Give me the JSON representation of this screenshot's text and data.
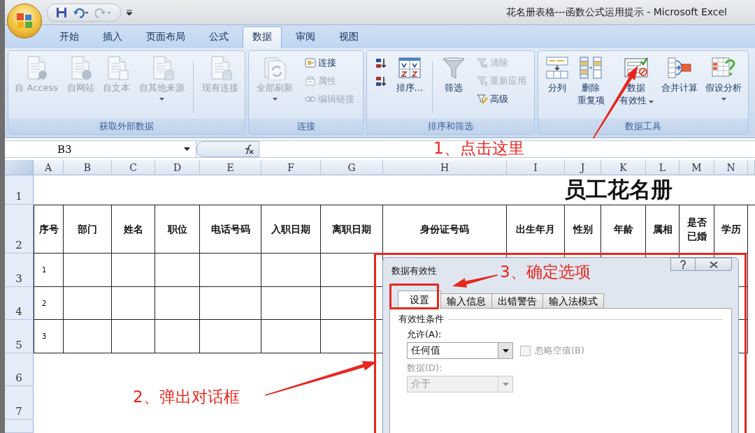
{
  "window": {
    "title": "花名册表格---函数公式运用提示 - Microsoft Excel"
  },
  "ribbon_tabs": [
    {
      "label": "开始",
      "selected": false
    },
    {
      "label": "插入",
      "selected": false
    },
    {
      "label": "页面布局",
      "selected": false
    },
    {
      "label": "公式",
      "selected": false
    },
    {
      "label": "数据",
      "selected": true
    },
    {
      "label": "审阅",
      "selected": false
    },
    {
      "label": "视图",
      "selected": false
    }
  ],
  "ribbon_groups": [
    {
      "title": "获取外部数据",
      "items": [
        {
          "kind": "large",
          "label": "自 Access",
          "disabled": true
        },
        {
          "kind": "large",
          "label": "自网站",
          "disabled": true
        },
        {
          "kind": "large",
          "label": "自文本",
          "disabled": true
        },
        {
          "kind": "large",
          "label": "自其他来源",
          "disabled": true,
          "dropdown": true
        },
        {
          "kind": "separator"
        },
        {
          "kind": "large",
          "label": "现有连接",
          "disabled": true
        }
      ]
    },
    {
      "title": "连接",
      "items": [
        {
          "kind": "large",
          "label": "全部刷新",
          "disabled": true,
          "dropdown": true
        },
        {
          "kind": "stack",
          "items": [
            {
              "label": "连接",
              "disabled": false
            },
            {
              "label": "属性",
              "disabled": true
            },
            {
              "label": "编辑链接",
              "disabled": true
            }
          ]
        }
      ]
    },
    {
      "title": "排序和筛选",
      "items": [
        {
          "kind": "stack",
          "items": [
            {
              "disabled": false
            },
            {
              "disabled": false
            }
          ]
        },
        {
          "kind": "large",
          "label": "排序...",
          "disabled": false
        },
        {
          "kind": "separator"
        },
        {
          "kind": "large",
          "label": "筛选",
          "disabled": false
        },
        {
          "kind": "stack",
          "items": [
            {
              "label": "清除",
              "disabled": true
            },
            {
              "label": "重新应用",
              "disabled": true
            },
            {
              "label": "高级",
              "disabled": false
            }
          ]
        }
      ]
    },
    {
      "title": "数据工具",
      "items": [
        {
          "kind": "large",
          "label": "分列",
          "disabled": false
        },
        {
          "kind": "large",
          "lines": [
            "删除",
            "重复项"
          ],
          "disabled": false
        },
        {
          "kind": "large",
          "lines": [
            "数据",
            "有效性"
          ],
          "disabled": false,
          "dropdown": true
        },
        {
          "kind": "large",
          "label": "合并计算",
          "disabled": false
        },
        {
          "kind": "large",
          "label": "假设分析",
          "disabled": false,
          "dropdown": true
        }
      ]
    }
  ],
  "formula_bar": {
    "name_box": "B3"
  },
  "sheet": {
    "columns": [
      "A",
      "B",
      "C",
      "D",
      "E",
      "F",
      "G",
      "H",
      "I",
      "J",
      "K",
      "L",
      "M",
      "N"
    ],
    "rows": [
      "1",
      "2",
      "3",
      "4",
      "5",
      "6",
      "7"
    ],
    "title": "员工花名册",
    "headers": [
      "序号",
      "部门",
      "姓名",
      "职位",
      "电话号码",
      "入职日期",
      "离职日期",
      "身份证号码",
      "出生年月",
      "性别",
      "年龄",
      "属相",
      [
        "是否",
        "已婚"
      ],
      "学历"
    ],
    "serials": [
      "1",
      "2",
      "3"
    ]
  },
  "dialog": {
    "title": "数据有效性",
    "tabs": [
      {
        "label": "设置",
        "selected": true
      },
      {
        "label": "输入信息",
        "selected": false
      },
      {
        "label": "出错警告",
        "selected": false
      },
      {
        "label": "输入法模式",
        "selected": false
      }
    ],
    "group_label": "有效性条件",
    "allow_label": "允许(A):",
    "allow_value": "任何值",
    "ignore_blank": {
      "label": "忽略空值(B)",
      "checked": false,
      "disabled": true
    },
    "data_label": "数据(D):",
    "data_value": "介于",
    "data_disabled": true
  },
  "annotations": [
    {
      "text": "1、点击这里"
    },
    {
      "text": "2、弹出对话框"
    },
    {
      "text": "3、确定选项"
    }
  ]
}
